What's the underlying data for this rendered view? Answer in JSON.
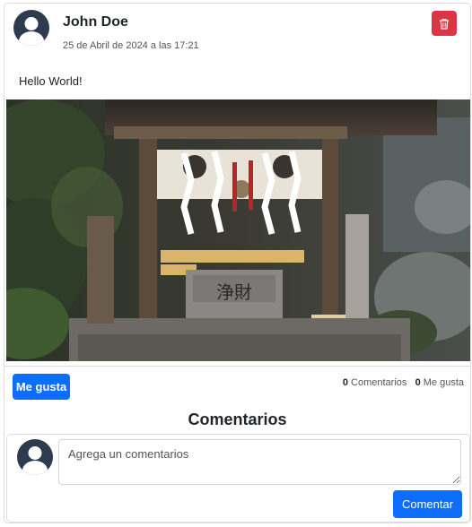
{
  "post": {
    "author": "John Doe",
    "date": "25 de Abril de 2024 a las 17:21",
    "text": "Hello World!",
    "image_alt": "Photo of a small wooden Japanese shrine",
    "shrine_sign": "浄財",
    "delete_icon": "trash-icon",
    "delete_color": "#dc3545"
  },
  "actions": {
    "like_label": "Me gusta",
    "comments_count": "0",
    "comments_label": "Comentarios",
    "likes_count": "0",
    "likes_label": "Me gusta",
    "accent_color": "#0d6efd"
  },
  "comments": {
    "title": "Comentarios",
    "placeholder": "Agrega un comentarios",
    "submit_label": "Comentar"
  }
}
